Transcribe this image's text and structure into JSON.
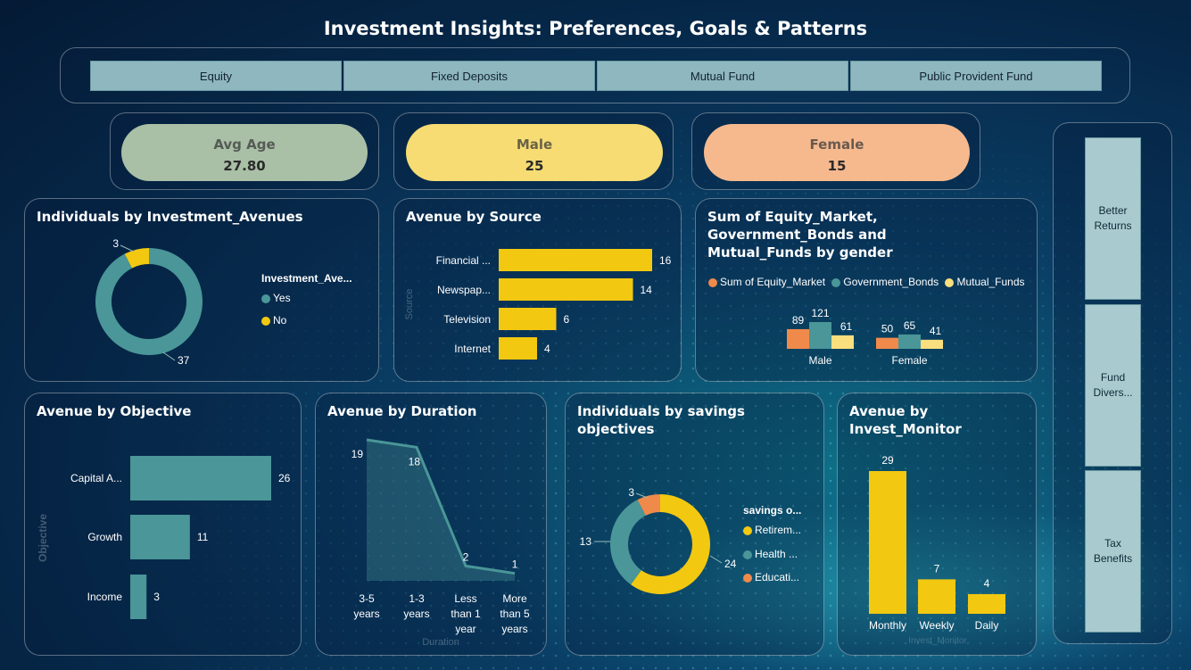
{
  "title": "Investment Insights: Preferences, Goals & Patterns",
  "slicer": [
    "Equity",
    "Fixed Deposits",
    "Mutual Fund",
    "Public Provident Fund"
  ],
  "kpis": {
    "avg_age": {
      "label": "Avg Age",
      "value": "27.80",
      "color": "#a9bfa6"
    },
    "male": {
      "label": "Male",
      "value": "25",
      "color": "#f6dc72"
    },
    "female": {
      "label": "Female",
      "value": "15",
      "color": "#f6b98e"
    }
  },
  "right_buttons": [
    "Better Returns",
    "Fund Divers...",
    "Tax Benefits"
  ],
  "colors": {
    "teal": "#4a9698",
    "yellow": "#f2c811",
    "orange": "#f08a4b",
    "lightyellow": "#f9df7e"
  },
  "chart_data": [
    {
      "id": "investment_avenues",
      "type": "pie",
      "title": "Individuals by Investment_Avenues",
      "legend_title": "Investment_Ave...",
      "categories": [
        "Yes",
        "No"
      ],
      "values": [
        37,
        3
      ]
    },
    {
      "id": "source",
      "type": "bar",
      "title": "Avenue by Source",
      "ylabel": "Source",
      "categories": [
        "Financial ...",
        "Newspap...",
        "Television",
        "Internet"
      ],
      "values": [
        16,
        14,
        6,
        4
      ]
    },
    {
      "id": "gender_sums",
      "type": "bar",
      "title": "Sum of Equity_Market, Government_Bonds and Mutual_Funds by gender",
      "categories": [
        "Male",
        "Female"
      ],
      "series": [
        {
          "name": "Sum of Equity_Market",
          "values": [
            89,
            50
          ]
        },
        {
          "name": "Government_Bonds",
          "values": [
            121,
            65
          ]
        },
        {
          "name": "Mutual_Funds",
          "values": [
            61,
            41
          ]
        }
      ]
    },
    {
      "id": "objective",
      "type": "bar",
      "title": "Avenue by Objective",
      "ylabel": "Objective",
      "categories": [
        "Capital A...",
        "Growth",
        "Income"
      ],
      "values": [
        26,
        11,
        3
      ]
    },
    {
      "id": "duration",
      "type": "area",
      "title": "Avenue by Duration",
      "xlabel": "Duration",
      "categories": [
        "3-5 years",
        "1-3 years",
        "Less than 1 year",
        "More than 5 years"
      ],
      "values": [
        19,
        18,
        2,
        1
      ]
    },
    {
      "id": "savings",
      "type": "pie",
      "title": "Individuals by savings objectives",
      "legend_title": "savings o...",
      "categories": [
        "Retirem...",
        "Health ...",
        "Educati..."
      ],
      "values": [
        24,
        13,
        3
      ]
    },
    {
      "id": "monitor",
      "type": "bar",
      "title": "Avenue by Invest_Monitor",
      "xlabel": "Invest_Monitor",
      "categories": [
        "Monthly",
        "Weekly",
        "Daily"
      ],
      "values": [
        29,
        7,
        4
      ]
    }
  ]
}
